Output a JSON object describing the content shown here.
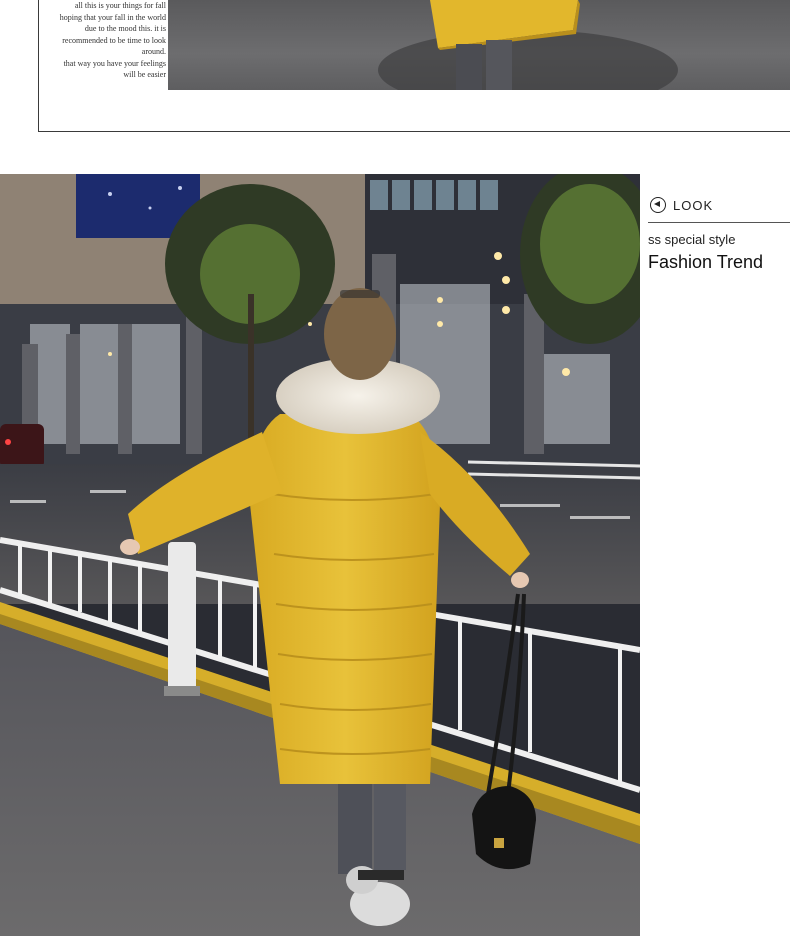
{
  "top_section": {
    "caption_lines": [
      "all this is your things for fall",
      "hoping that your fall in the world",
      "due to the mood this. it is",
      "recommended to be time to look",
      "around.",
      "that way you have your feelings",
      "will be easier"
    ]
  },
  "side_panel": {
    "look_label": "LOOK",
    "subtitle": "ss special style",
    "title": "Fashion Trend"
  },
  "colors": {
    "coat_yellow": "#e2b72c",
    "fur_cream": "#ece6dc",
    "rail_white": "#eeeeee",
    "curb_yellow": "#d6ae2a"
  }
}
